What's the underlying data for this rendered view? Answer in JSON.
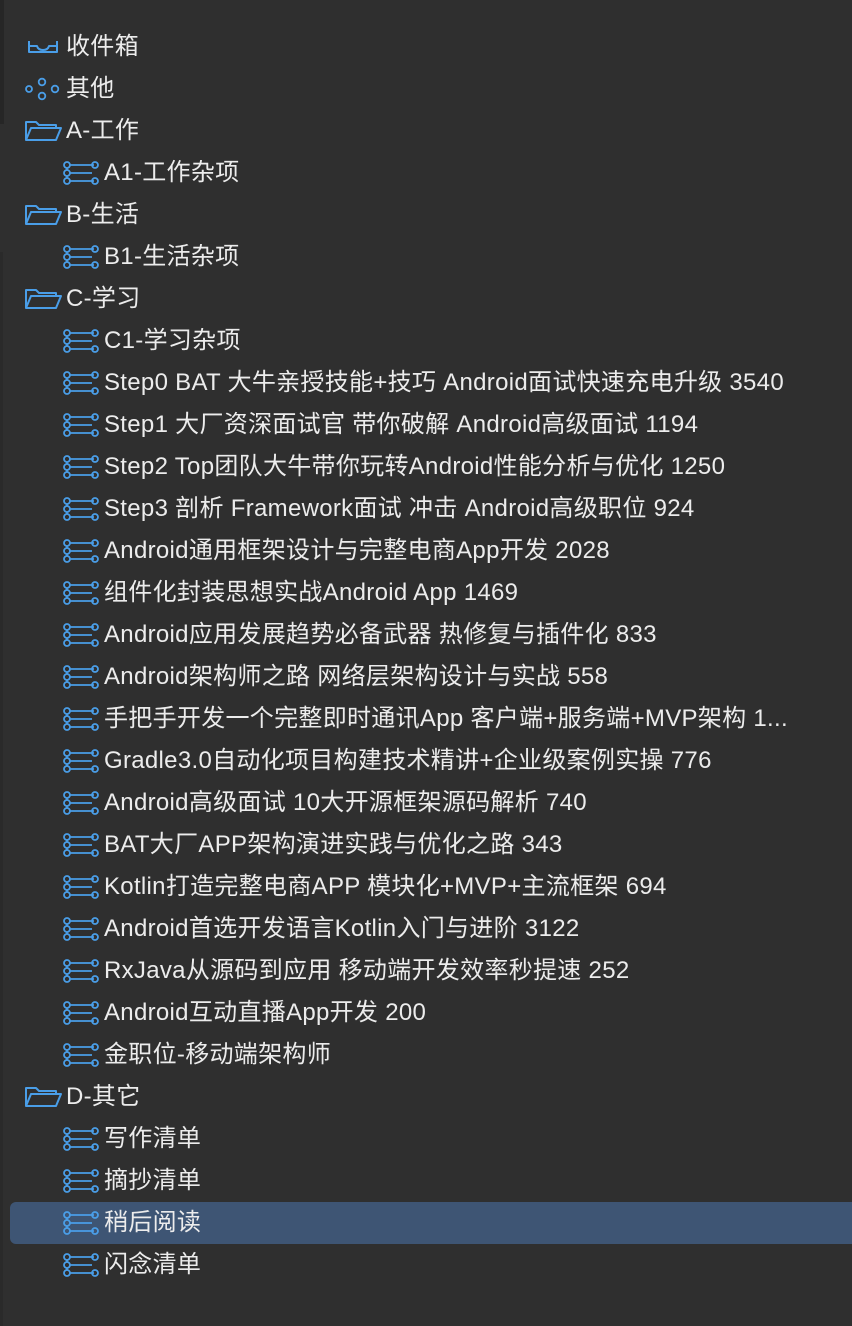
{
  "colors": {
    "background": "#2f2f2f",
    "selection": "#3e5574",
    "icon_blue": "#4a9ee8",
    "text": "#ececec"
  },
  "sidebar": {
    "items": [
      {
        "label": "收件箱",
        "icon": "inbox-tray-icon",
        "level": 0
      },
      {
        "label": "其他",
        "icon": "other-nodes-icon",
        "level": 0
      },
      {
        "label": "A-工作",
        "icon": "folder-icon",
        "level": 0
      },
      {
        "label": "A1-工作杂项",
        "icon": "list-icon",
        "level": 1
      },
      {
        "label": "B-生活",
        "icon": "folder-icon",
        "level": 0
      },
      {
        "label": "B1-生活杂项",
        "icon": "list-icon",
        "level": 1
      },
      {
        "label": "C-学习",
        "icon": "folder-icon",
        "level": 0
      },
      {
        "label": "C1-学习杂项",
        "icon": "list-icon",
        "level": 1
      },
      {
        "label": "Step0 BAT 大牛亲授技能+技巧 Android面试快速充电升级 3540",
        "icon": "list-icon",
        "level": 1
      },
      {
        "label": "Step1 大厂资深面试官 带你破解 Android高级面试 1194",
        "icon": "list-icon",
        "level": 1
      },
      {
        "label": "Step2 Top团队大牛带你玩转Android性能分析与优化 1250",
        "icon": "list-icon",
        "level": 1
      },
      {
        "label": "Step3 剖析 Framework面试 冲击 Android高级职位 924",
        "icon": "list-icon",
        "level": 1
      },
      {
        "label": "Android通用框架设计与完整电商App开发 2028",
        "icon": "list-icon",
        "level": 1
      },
      {
        "label": "组件化封装思想实战Android App 1469",
        "icon": "list-icon",
        "level": 1
      },
      {
        "label": "Android应用发展趋势必备武器 热修复与插件化 833",
        "icon": "list-icon",
        "level": 1
      },
      {
        "label": "Android架构师之路 网络层架构设计与实战 558",
        "icon": "list-icon",
        "level": 1
      },
      {
        "label": "手把手开发一个完整即时通讯App 客户端+服务端+MVP架构 1...",
        "icon": "list-icon",
        "level": 1
      },
      {
        "label": "Gradle3.0自动化项目构建技术精讲+企业级案例实操 776",
        "icon": "list-icon",
        "level": 1
      },
      {
        "label": "Android高级面试 10大开源框架源码解析 740",
        "icon": "list-icon",
        "level": 1
      },
      {
        "label": "BAT大厂APP架构演进实践与优化之路 343",
        "icon": "list-icon",
        "level": 1
      },
      {
        "label": "Kotlin打造完整电商APP 模块化+MVP+主流框架 694",
        "icon": "list-icon",
        "level": 1
      },
      {
        "label": "Android首选开发语言Kotlin入门与进阶 3122",
        "icon": "list-icon",
        "level": 1
      },
      {
        "label": "RxJava从源码到应用 移动端开发效率秒提速 252",
        "icon": "list-icon",
        "level": 1
      },
      {
        "label": "Android互动直播App开发 200",
        "icon": "list-icon",
        "level": 1
      },
      {
        "label": "金职位-移动端架构师",
        "icon": "list-icon",
        "level": 1
      },
      {
        "label": "D-其它",
        "icon": "folder-icon",
        "level": 0
      },
      {
        "label": "写作清单",
        "icon": "list-icon",
        "level": 1
      },
      {
        "label": "摘抄清单",
        "icon": "list-icon",
        "level": 1
      },
      {
        "label": "稍后阅读",
        "icon": "list-icon",
        "level": 1,
        "selected": true
      },
      {
        "label": "闪念清单",
        "icon": "list-icon",
        "level": 1
      }
    ]
  }
}
